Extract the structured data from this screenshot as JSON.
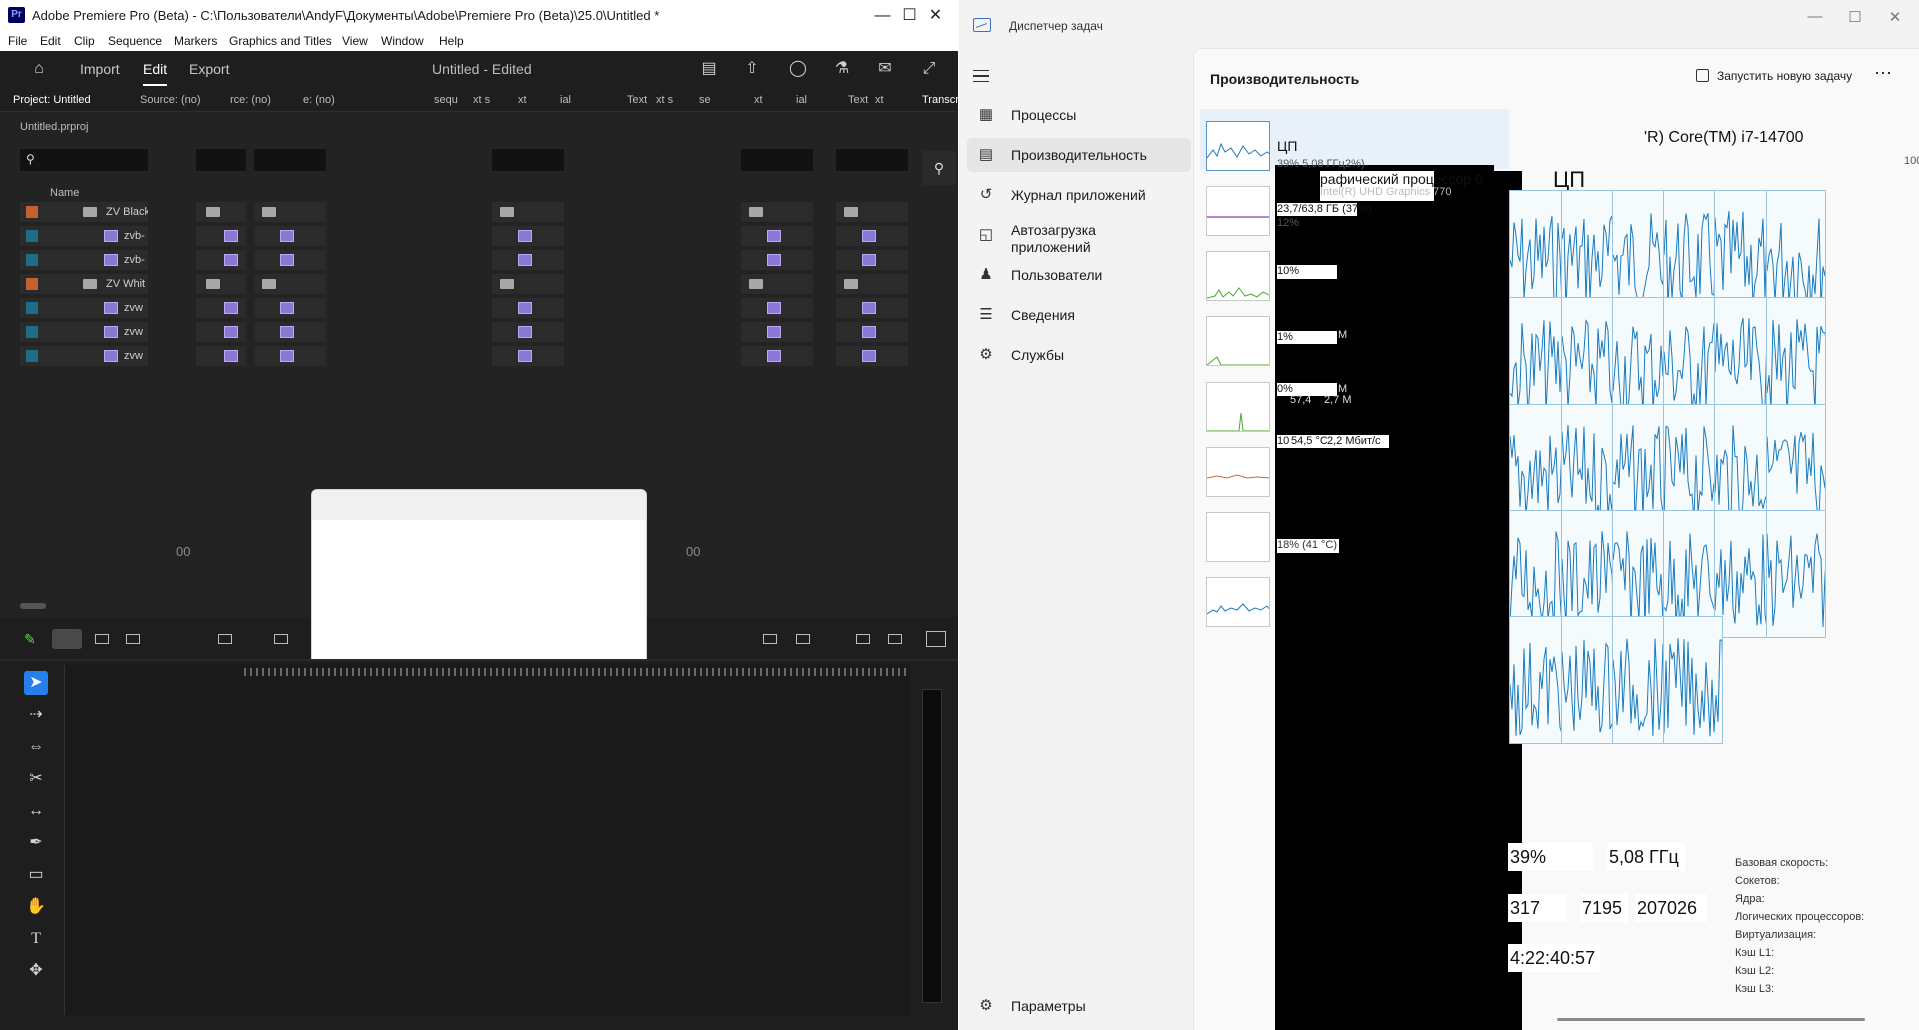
{
  "premiere": {
    "title": "Adobe Premiere Pro (Beta) - C:\\Пользователи\\AndyF\\Документы\\Adobe\\Premiere Pro (Beta)\\25.0\\Untitled *",
    "menu": [
      "File",
      "Edit",
      "Clip",
      "Sequence",
      "Markers",
      "Graphics and Titles",
      "View",
      "Window",
      "Help"
    ],
    "header_tabs": [
      "Import",
      "Edit",
      "Export"
    ],
    "doc_title": "Untitled - Edited",
    "panel_tabs": [
      "Project: Untitled",
      "Source: (no)",
      "rce: (no)",
      "e: (no)",
      "sequ",
      "xt s",
      "xt",
      "ial",
      "Text",
      "xt s",
      "se",
      "xt",
      "ial",
      "Text",
      "xt",
      "Transcr"
    ],
    "project_file": "Untitled.prproj",
    "column_header": "Name",
    "rows": [
      {
        "name": "ZV Black",
        "kind": "bin",
        "label": "orange"
      },
      {
        "name": "zvb-",
        "kind": "clip",
        "label": "teal"
      },
      {
        "name": "zvb-",
        "kind": "clip",
        "label": "teal"
      },
      {
        "name": "ZV Whit",
        "kind": "bin",
        "label": "orange"
      },
      {
        "name": "zvw",
        "kind": "clip",
        "label": "teal"
      },
      {
        "name": "zvw",
        "kind": "clip",
        "label": "teal"
      },
      {
        "name": "zvw",
        "kind": "clip",
        "label": "teal"
      }
    ],
    "timecode": "00",
    "tools": [
      "selection-tool",
      "track-select-tool",
      "ripple-edit-tool",
      "razor-tool",
      "slip-tool",
      "pen-tool",
      "rectangle-tool",
      "hand-tool",
      "type-tool",
      "remix-tool"
    ]
  },
  "taskmgr": {
    "title": "Диспетчер задач",
    "nav": [
      {
        "label": "Процессы",
        "icon": "processes-icon"
      },
      {
        "label": "Производительность",
        "icon": "performance-icon"
      },
      {
        "label": "Журнал приложений",
        "icon": "history-icon"
      },
      {
        "label": "Автозагрузка приложений",
        "icon": "startup-icon"
      },
      {
        "label": "Пользователи",
        "icon": "users-icon"
      },
      {
        "label": "Сведения",
        "icon": "details-icon"
      },
      {
        "label": "Службы",
        "icon": "services-icon"
      }
    ],
    "settings": "Параметры",
    "page_title": "Производительность",
    "new_task": "Запустить новую задачу",
    "sidebar": {
      "cpu_name": "ЦП",
      "cpu_value": "39% 5,08 ГГц",
      "cpu_value2": "2%)",
      "gpu_title": "рафический процессор 0",
      "gpu_sub": "Intel(R) UHD Graphics 770",
      "mem_value": "23,7/63,8 ГБ (37%)",
      "mem_pct": "12%",
      "disk0": "10%",
      "disk1": "1%",
      "disk2": "0%",
      "disk2b": "57,4",
      "disk2c": "2,7 М",
      "net_value": "10",
      "net_temp": "54,5 °C",
      "net_speed": "2,2 Мбит/с",
      "gpu_value": "18% (41 °C)",
      "m_small": "М",
      "m_small2": "М"
    },
    "detail": {
      "title": "ЦП",
      "model": "'R) Core(TM) i7-14700",
      "max_label": "100",
      "usage": "39%",
      "speed": "5,08 ГГц",
      "processes": "317",
      "threads": "7195",
      "handles": "207026",
      "uptime": "4:22:40:57",
      "stat_labels": [
        "Базовая скорость:",
        "Сокетов:",
        "Ядра:",
        "Логических процессоров:",
        "Виртуализация:",
        "Кэш L1:",
        "Кэш L2:",
        "Кэш L3:"
      ]
    }
  }
}
